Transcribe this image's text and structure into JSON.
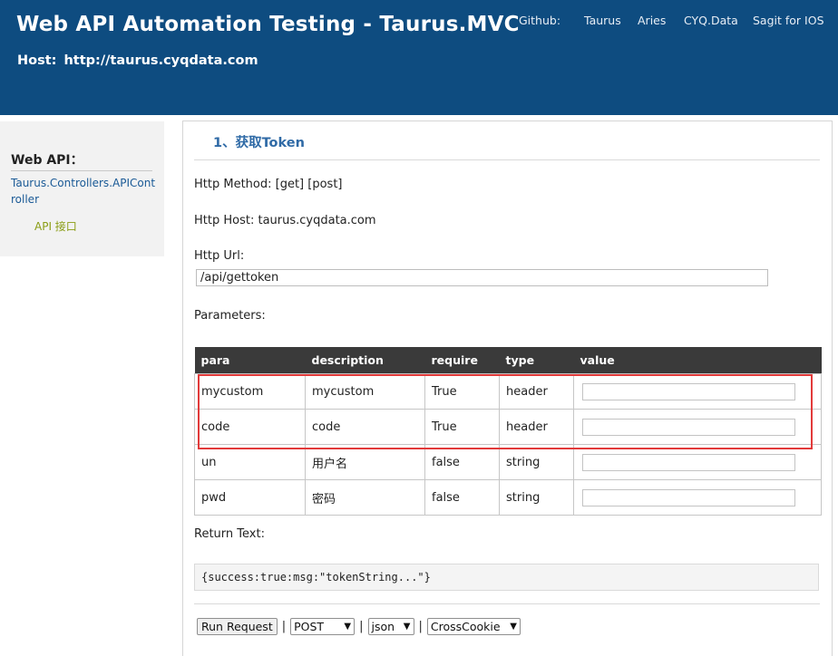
{
  "header": {
    "title": "Web API Automation Testing - Taurus.MVC",
    "host_label": "Host:",
    "host_value": "http://taurus.cyqdata.com",
    "nav": [
      "Github:",
      "Taurus",
      "Aries",
      "CYQ.Data",
      "Sagit for IOS"
    ]
  },
  "sidebar": {
    "title": "Web API：",
    "controller": "Taurus.Controllers.APIController",
    "sub_item": "API 接口"
  },
  "section": {
    "title": "1、获取Token",
    "method_label": "Http Method:",
    "method_value": "[get] [post]",
    "host_label": "Http Host:",
    "host_value": "taurus.cyqdata.com",
    "url_label": "Http Url:",
    "url_value": "/api/gettoken",
    "params_label": "Parameters:",
    "return_label": "Return Text:",
    "return_value": "{success:true:msg:\"tokenString...\"}"
  },
  "table": {
    "headers": [
      "para",
      "description",
      "require",
      "type",
      "value"
    ],
    "rows": [
      {
        "para": "mycustom",
        "description": "mycustom",
        "require": "True",
        "type": "header",
        "value": ""
      },
      {
        "para": "code",
        "description": "code",
        "require": "True",
        "type": "header",
        "value": ""
      },
      {
        "para": "un",
        "description": "用户名",
        "require": "false",
        "type": "string",
        "value": ""
      },
      {
        "para": "pwd",
        "description": "密码",
        "require": "false",
        "type": "string",
        "value": ""
      }
    ]
  },
  "controls": {
    "run_label": "Run Request",
    "separator": "|",
    "method_select": "POST",
    "format_select": "json",
    "cookie_select": "CrossCookie"
  },
  "colors": {
    "header_bg": "#0e4c80",
    "table_header_bg": "#3a3a3a",
    "highlight_border": "#e23a3a",
    "link": "#1a5a96",
    "section_title": "#2f6aa6"
  }
}
